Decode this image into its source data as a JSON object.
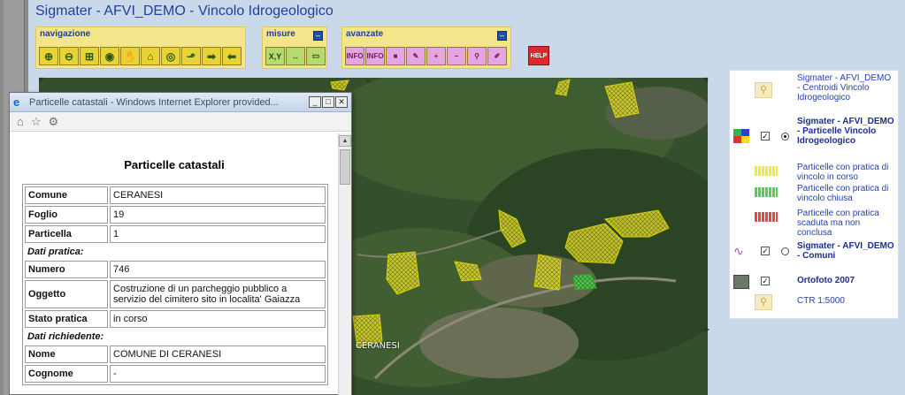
{
  "app": {
    "title": "Sigmater - AFVI_DEMO - Vincolo Idrogeologico"
  },
  "toolbar": {
    "navigazione": {
      "title": "navigazione",
      "buttons": [
        {
          "name": "zoom-in-icon",
          "glyph": "⊕"
        },
        {
          "name": "zoom-out-icon",
          "glyph": "⊖"
        },
        {
          "name": "zoom-box-icon",
          "glyph": "⊞"
        },
        {
          "name": "zoom-prev-icon",
          "glyph": "◉"
        },
        {
          "name": "pan-hand-icon",
          "glyph": "✋"
        },
        {
          "name": "home-icon",
          "glyph": "⌂"
        },
        {
          "name": "full-extent-icon",
          "glyph": "◎"
        },
        {
          "name": "select-icon",
          "glyph": "⬏"
        },
        {
          "name": "forward-arrow-icon",
          "glyph": "➡"
        },
        {
          "name": "back-arrow-icon",
          "glyph": "⬅"
        }
      ]
    },
    "misure": {
      "title": "misure",
      "buttons": [
        {
          "name": "coordinates-icon",
          "glyph": "X,Y"
        },
        {
          "name": "measure-distance-icon",
          "glyph": "↔"
        },
        {
          "name": "measure-area-icon",
          "glyph": "▭"
        }
      ]
    },
    "avanzate": {
      "title": "avanzate",
      "buttons": [
        {
          "name": "info-icon",
          "glyph": "INFO"
        },
        {
          "name": "info-select-icon",
          "glyph": "INFO"
        },
        {
          "name": "layer-green-icon",
          "glyph": "■"
        },
        {
          "name": "eraser-icon",
          "glyph": "✎"
        },
        {
          "name": "add-icon",
          "glyph": "+"
        },
        {
          "name": "remove-icon",
          "glyph": "−"
        },
        {
          "name": "binoculars-icon",
          "glyph": "⚲"
        },
        {
          "name": "edit-icon",
          "glyph": "✐"
        }
      ]
    },
    "help": {
      "label": "HELP"
    },
    "collapse": "–"
  },
  "popup": {
    "window_title": "Particelle catastali - Windows Internet Explorer provided...",
    "heading": "Particelle catastali",
    "rows": [
      {
        "type": "kv",
        "key": "Comune",
        "value": "CERANESI"
      },
      {
        "type": "kv",
        "key": "Foglio",
        "value": "19"
      },
      {
        "type": "kv",
        "key": "Particella",
        "value": "1"
      },
      {
        "type": "section",
        "key": "Dati pratica:"
      },
      {
        "type": "kv",
        "key": "Numero",
        "value": "746"
      },
      {
        "type": "kv",
        "key": "Oggetto",
        "value": "Costruzione di un parcheggio pubblico a servizio del cimitero sito in localita' Gaiazza"
      },
      {
        "type": "kv",
        "key": "Stato pratica",
        "value": "in corso"
      },
      {
        "type": "section",
        "key": "Dati richiedente:"
      },
      {
        "type": "kv",
        "key": "Nome",
        "value": "COMUNE DI CERANESI"
      },
      {
        "type": "kv",
        "key": "Cognome",
        "value": "-"
      }
    ]
  },
  "map": {
    "place_label": "CERANESI"
  },
  "legend": {
    "items": [
      {
        "label": "Sigmater - AFVI_DEMO - Centroidi Vincolo Idrogeologico",
        "bold": false,
        "kind": "lens"
      },
      {
        "label": "Sigmater - AFVI_DEMO - Particelle Vincolo Idrogeologico",
        "bold": true,
        "kind": "layer",
        "checked": true,
        "radio": true
      },
      {
        "label": "Particelle con pratica di vincolo in corso",
        "bold": false,
        "kind": "swatch",
        "color": "#f0ec30"
      },
      {
        "label": "Particelle con pratica di vincolo chiusa",
        "bold": false,
        "kind": "swatch",
        "color": "#4fd14f"
      },
      {
        "label": "Particelle con pratica scaduta ma non conclusa",
        "bold": false,
        "kind": "swatch",
        "color": "#e04848"
      },
      {
        "label": "Sigmater - AFVI_DEMO - Comuni",
        "bold": true,
        "kind": "layer-line",
        "checked": true,
        "radio": false
      },
      {
        "label": "Ortofoto 2007",
        "bold": true,
        "kind": "layer-photo",
        "checked": true
      },
      {
        "label": "CTR 1:5000",
        "bold": false,
        "kind": "lens"
      }
    ]
  }
}
